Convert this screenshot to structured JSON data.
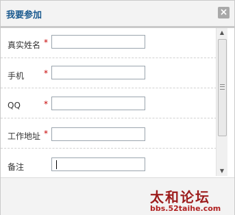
{
  "dialog": {
    "title": "我要参加",
    "close_icon": "close-icon"
  },
  "form": {
    "fields": [
      {
        "label": "真实姓名",
        "required": true,
        "value": ""
      },
      {
        "label": "手机",
        "required": true,
        "value": ""
      },
      {
        "label": "QQ",
        "required": true,
        "value": ""
      },
      {
        "label": "工作地址",
        "required": true,
        "value": ""
      },
      {
        "label": "备注",
        "required": false,
        "value": ""
      }
    ],
    "required_mark": "*"
  },
  "footer": {
    "brand_title": "太和论坛",
    "brand_url": "bbs.52taihe.com"
  },
  "colors": {
    "title": "#1b5a8f",
    "required": "#c60000",
    "brand": "#9c1c1c"
  }
}
